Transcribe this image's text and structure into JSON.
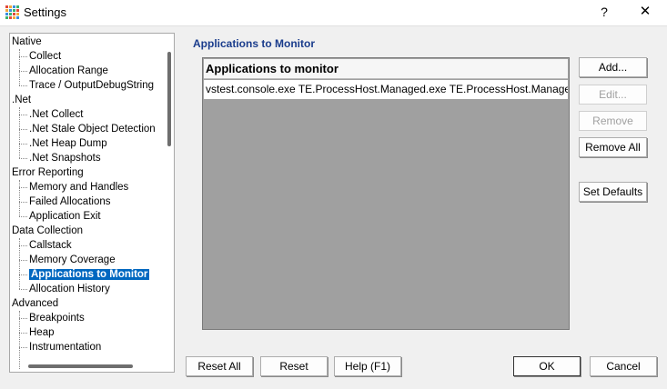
{
  "window": {
    "title": "Settings",
    "help_glyph": "?",
    "close_glyph": "✕"
  },
  "tree": {
    "items": [
      {
        "label": "Native",
        "level": 0
      },
      {
        "label": "Collect",
        "level": 1
      },
      {
        "label": "Allocation Range",
        "level": 1
      },
      {
        "label": "Trace / OutputDebugString",
        "level": 1
      },
      {
        "label": ".Net",
        "level": 0
      },
      {
        "label": ".Net Collect",
        "level": 1
      },
      {
        "label": ".Net Stale Object Detection",
        "level": 1
      },
      {
        "label": ".Net Heap Dump",
        "level": 1
      },
      {
        "label": ".Net Snapshots",
        "level": 1
      },
      {
        "label": "Error Reporting",
        "level": 0
      },
      {
        "label": "Memory and Handles",
        "level": 1
      },
      {
        "label": "Failed Allocations",
        "level": 1
      },
      {
        "label": "Application Exit",
        "level": 1
      },
      {
        "label": "Data Collection",
        "level": 0
      },
      {
        "label": "Callstack",
        "level": 1
      },
      {
        "label": "Memory Coverage",
        "level": 1
      },
      {
        "label": "Applications to Monitor",
        "level": 1,
        "selected": true
      },
      {
        "label": "Allocation History",
        "level": 1
      },
      {
        "label": "Advanced",
        "level": 0
      },
      {
        "label": "Breakpoints",
        "level": 1
      },
      {
        "label": "Heap",
        "level": 1
      },
      {
        "label": "Instrumentation",
        "level": 1
      }
    ]
  },
  "main": {
    "section_title": "Applications to Monitor",
    "list_header": "Applications to monitor",
    "list_rows": [
      "vstest.console.exe TE.ProcessHost.Managed.exe TE.ProcessHost.Managed..."
    ]
  },
  "side_buttons": {
    "add": "Add...",
    "edit": "Edit...",
    "remove": "Remove",
    "remove_all": "Remove All",
    "set_defaults": "Set Defaults"
  },
  "bottom_buttons": {
    "reset_all": "Reset All",
    "reset": "Reset",
    "help": "Help (F1)",
    "ok": "OK",
    "cancel": "Cancel"
  },
  "colors": {
    "selection": "#0067c0",
    "section_title": "#1a3c8c",
    "list_background": "#a0a0a0"
  }
}
